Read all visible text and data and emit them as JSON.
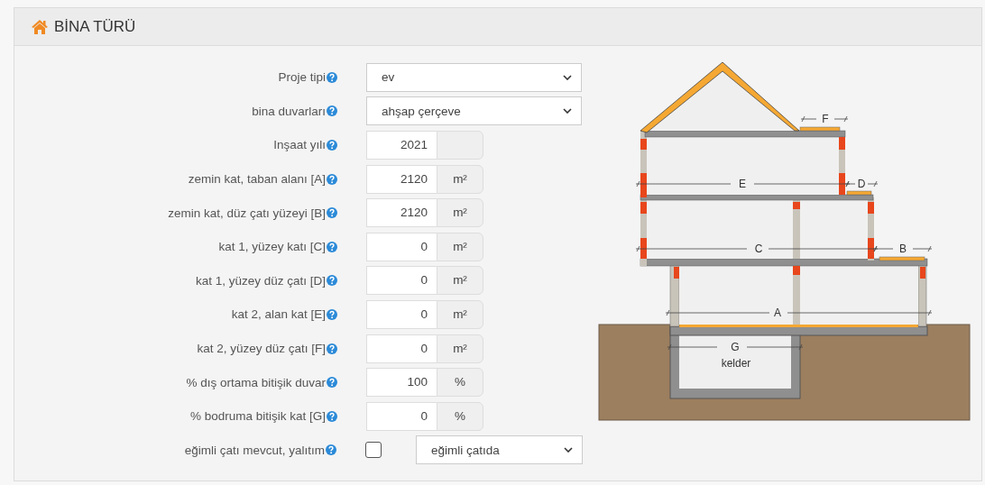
{
  "panel": {
    "title": "BİNA TÜRÜ"
  },
  "fields": [
    {
      "kind": "select",
      "label": "Proje tipi",
      "value": "ev"
    },
    {
      "kind": "select",
      "label": "bina duvarları",
      "value": "ahşap çerçeve"
    },
    {
      "kind": "number",
      "label": "Inşaat yılı",
      "value": "2021"
    },
    {
      "kind": "number",
      "label": "zemin kat, taban alanı [A]",
      "value": "2120",
      "unit": "m²"
    },
    {
      "kind": "number",
      "label": "zemin kat, düz çatı yüzeyi [B]",
      "value": "2120",
      "unit": "m²"
    },
    {
      "kind": "number",
      "label": "kat 1, yüzey katı [C]",
      "value": "0",
      "unit": "m²"
    },
    {
      "kind": "number",
      "label": "kat 1, yüzey düz çatı [D]",
      "value": "0",
      "unit": "m²"
    },
    {
      "kind": "number",
      "label": "kat 2, alan kat [E]",
      "value": "0",
      "unit": "m²"
    },
    {
      "kind": "number",
      "label": "kat 2, yüzey düz çatı [F]",
      "value": "0",
      "unit": "m²"
    },
    {
      "kind": "number",
      "label": "% dış ortama bitişik duvar",
      "value": "100",
      "unit": "%"
    },
    {
      "kind": "number",
      "label": "% bodruma bitişik kat [G]",
      "value": "0",
      "unit": "%"
    },
    {
      "kind": "checkbox-select",
      "label": "eğimli çatı mevcut, yalıtım",
      "checked": false,
      "value": "eğimli çatıda"
    }
  ],
  "diagram": {
    "labels": [
      {
        "text": "F"
      },
      {
        "text": "E"
      },
      {
        "text": "D"
      },
      {
        "text": "C"
      },
      {
        "text": "B"
      },
      {
        "text": "A"
      },
      {
        "text": "G"
      },
      {
        "text": "kelder"
      }
    ]
  }
}
